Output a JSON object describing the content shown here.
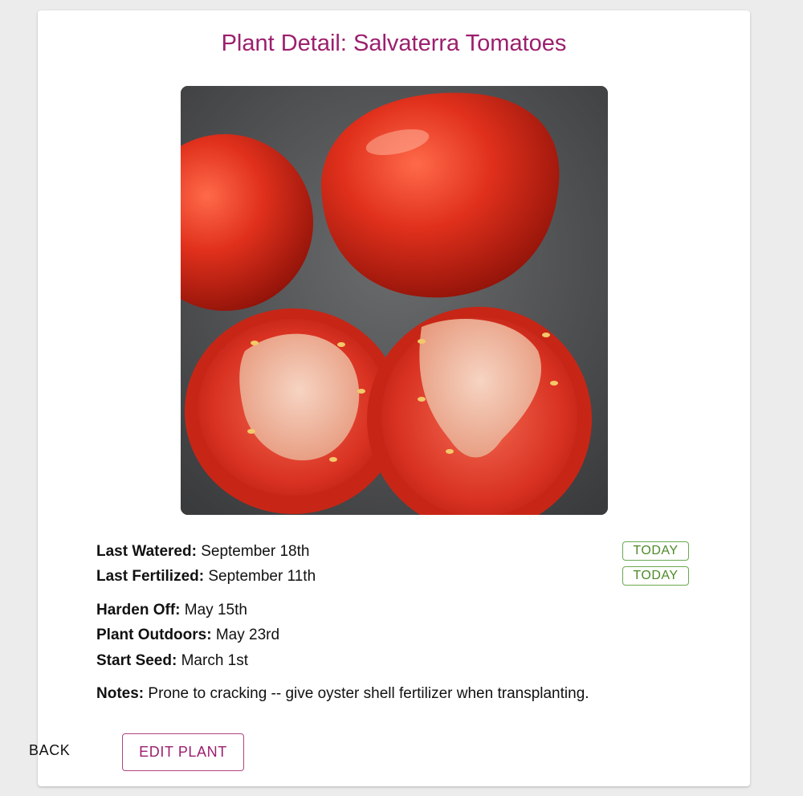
{
  "page": {
    "title": "Plant Detail: Salvaterra Tomatoes"
  },
  "plant": {
    "image_alt": "Salvaterra tomatoes",
    "fields": {
      "last_watered": {
        "label": "Last Watered:",
        "value": "September 18th"
      },
      "last_fertilized": {
        "label": "Last Fertilized:",
        "value": "September 11th"
      },
      "harden_off": {
        "label": "Harden Off:",
        "value": "May 15th"
      },
      "plant_outdoors": {
        "label": "Plant Outdoors:",
        "value": "May 23rd"
      },
      "start_seed": {
        "label": "Start Seed:",
        "value": "March 1st"
      },
      "notes": {
        "label": "Notes:",
        "value": "Prone to cracking -- give oyster shell fertilizer when transplanting."
      }
    }
  },
  "actions": {
    "today_watered_label": "TODAY",
    "today_fertilized_label": "TODAY",
    "back_label": "BACK",
    "edit_label": "EDIT PLANT"
  },
  "colors": {
    "accent": "#9c1f6e",
    "chip_green": "#4d8a2a",
    "background": "#ececec"
  }
}
